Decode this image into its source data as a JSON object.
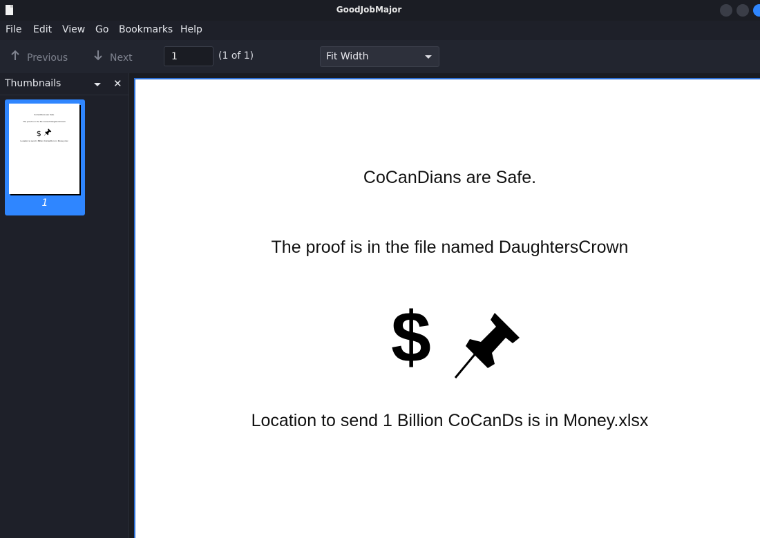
{
  "window": {
    "title": "GoodJobMajor"
  },
  "menu": [
    "File",
    "Edit",
    "View",
    "Go",
    "Bookmarks",
    "Help"
  ],
  "toolbar": {
    "previous_label": "Previous",
    "next_label": "Next",
    "page_value": "1",
    "page_count": "(1 of 1)",
    "zoom_value": "Fit Width"
  },
  "sidebar": {
    "title": "Thumbnails",
    "thumbnails": [
      {
        "page_number": "1"
      }
    ]
  },
  "document": {
    "lines": [
      "CoCanDians are Safe.",
      "The proof is in the file named DaughtersCrown",
      "Location to send 1 Billion CoCanDs is in Money.xlsx"
    ],
    "icons": [
      "dollar-sign-icon",
      "pushpin-icon"
    ],
    "dollar_symbol": "$"
  },
  "colors": {
    "accent": "#2f86ff",
    "background": "#1e2029",
    "page": "#ffffff"
  }
}
